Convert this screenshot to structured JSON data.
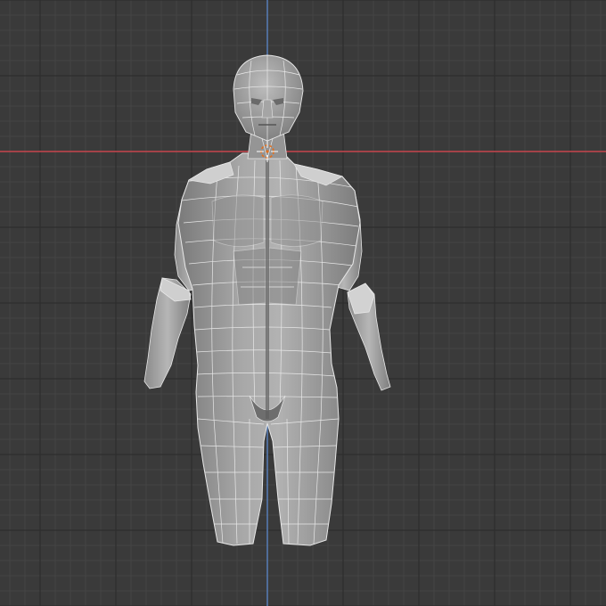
{
  "viewport": {
    "background_color": "#3a3a3a",
    "grid_minor_color": "#444444",
    "grid_major_color": "#2e2e2e",
    "x_axis_color": "#c8474f",
    "y_axis_color": "#5a84c2",
    "mesh_fill_color": "#9a9a9a",
    "mesh_shade_color": "#6e6e6e",
    "mesh_highlight_color": "#c4c4c4",
    "wire_color": "#e8e8e8",
    "cursor_color": "#e07020",
    "icons": {
      "cursor": "3d-cursor-icon",
      "model": "humanoid-mesh-icon"
    }
  }
}
